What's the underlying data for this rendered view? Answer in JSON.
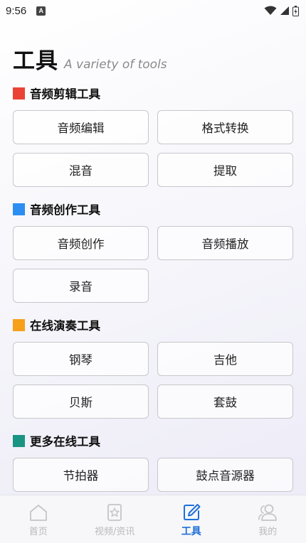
{
  "status_bar": {
    "time": "9:56",
    "notification_letter": "A"
  },
  "header": {
    "title": "工具",
    "subtitle": "A variety of tools"
  },
  "sections": [
    {
      "title": "音频剪辑工具",
      "color": "#ea4335",
      "buttons": [
        "音频编辑",
        "格式转换",
        "混音",
        "提取"
      ]
    },
    {
      "title": "音频创作工具",
      "color": "#2b8ef0",
      "buttons": [
        "音频创作",
        "音频播放",
        "录音"
      ]
    },
    {
      "title": "在线演奏工具",
      "color": "#f7a01a",
      "buttons": [
        "钢琴",
        "吉他",
        "贝斯",
        "套鼓"
      ]
    },
    {
      "title": "更多在线工具",
      "color": "#1a9483",
      "buttons": [
        "节拍器",
        "鼓点音源器"
      ]
    }
  ],
  "tab_bar": {
    "tabs": [
      {
        "label": "首页",
        "icon": "home-icon",
        "active": false
      },
      {
        "label": "视频/资讯",
        "icon": "bookmark-star-icon",
        "active": false
      },
      {
        "label": "工具",
        "icon": "edit-icon",
        "active": true
      },
      {
        "label": "我的",
        "icon": "users-icon",
        "active": false
      }
    ]
  },
  "colors": {
    "accent": "#1e6fd9",
    "inactive": "#b8b8be"
  }
}
